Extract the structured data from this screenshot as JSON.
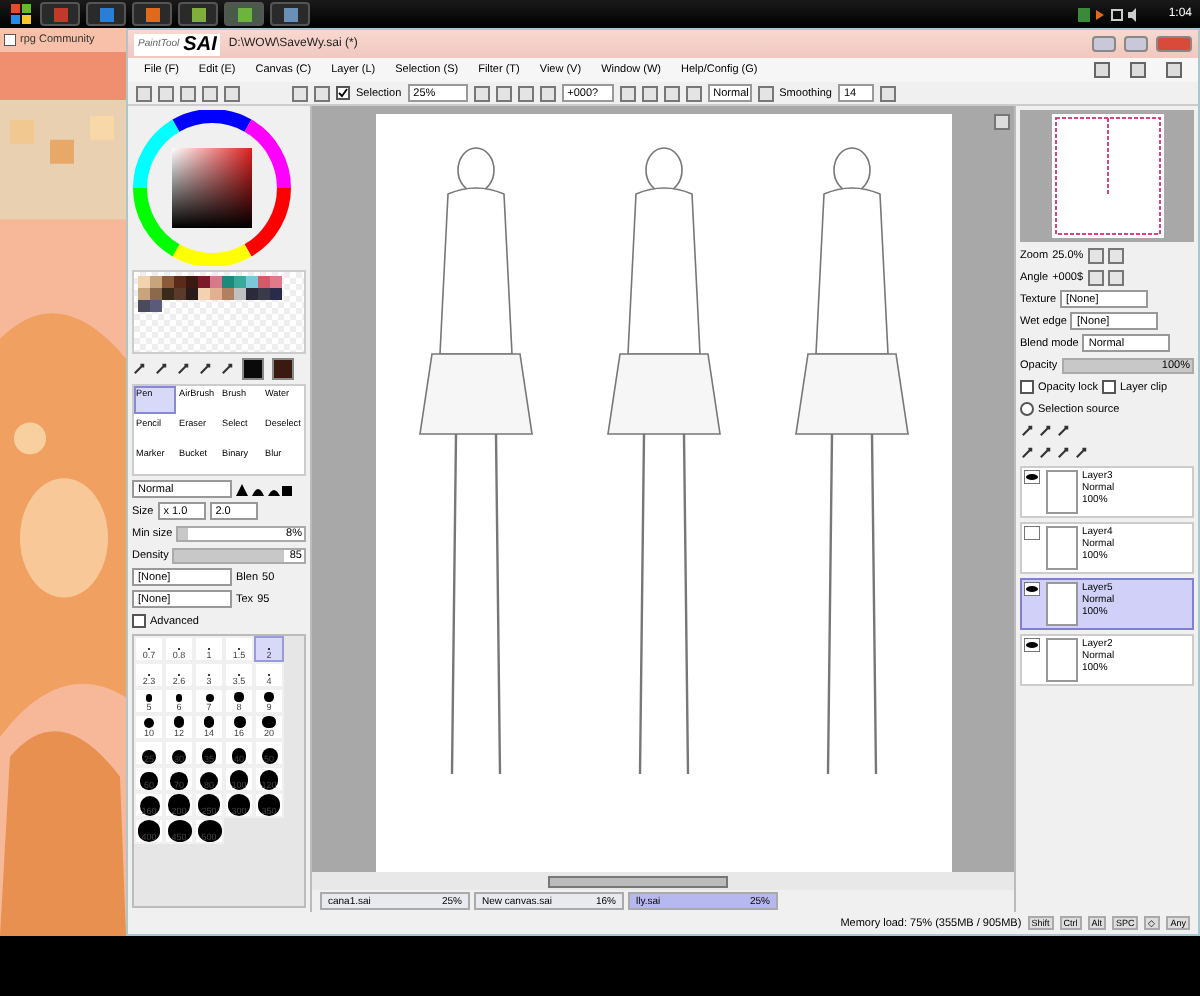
{
  "taskbar": {
    "apps": [
      {
        "color": "#c0392b",
        "selected": false
      },
      {
        "color": "#2a7fd4",
        "selected": false
      },
      {
        "color": "#e06a1a",
        "selected": false
      },
      {
        "color": "#7fae3a",
        "selected": false
      },
      {
        "color": "#6db33f",
        "selected": true
      },
      {
        "color": "#6a90b8",
        "selected": false
      }
    ],
    "clock": "1:04"
  },
  "browser": {
    "tab": "rpg Community"
  },
  "window": {
    "logo_sub": "PaintTool",
    "logo": "SAI",
    "title": "D:\\WOW\\SaveWy.sai (*)"
  },
  "menu": [
    "File (F)",
    "Edit (E)",
    "Canvas (C)",
    "Layer (L)",
    "Selection (S)",
    "Filter (T)",
    "View (V)",
    "Window (W)",
    "Help/Config (G)"
  ],
  "toolbar": {
    "selection_checked": true,
    "selection_label": "Selection",
    "zoom": "25%",
    "angle": "+000?",
    "blend": "Normal",
    "smoothing_label": "Smoothing",
    "smoothing": "14"
  },
  "swatches": [
    {
      "color": "#f2d2b0"
    },
    {
      "color": "#c8a47c"
    },
    {
      "color": "#8a5a3a"
    },
    {
      "color": "#5a2a1a"
    },
    {
      "color": "#3a1a10"
    },
    {
      "color": "#7a1a2a"
    },
    {
      "color": "#d47a8a"
    },
    {
      "color": "#1a8a7a"
    },
    {
      "color": "#3aa89a"
    },
    {
      "color": "#7ac8d8"
    },
    {
      "color": "#d45a6a"
    },
    {
      "color": "#e07a8a"
    },
    {
      "color": "#c8a47c"
    },
    {
      "color": "#8a6a4a"
    },
    {
      "color": "#3a2a1a"
    },
    {
      "color": "#5a3a2a"
    },
    {
      "color": "#2a1a1a"
    },
    {
      "color": "#f2d2b0"
    },
    {
      "color": "#e0b090"
    },
    {
      "color": "#b08060"
    },
    {
      "color": "#c0c0c0"
    },
    {
      "color": "#2a2a3a"
    },
    {
      "color": "#3a3a4a"
    },
    {
      "color": "#2a2a4a"
    },
    {
      "color": "#4a4a5a"
    },
    {
      "color": "#5a5a7a"
    }
  ],
  "brush_tools": [
    {
      "label": "Pen",
      "selected": true
    },
    {
      "label": "AirBrush",
      "selected": false
    },
    {
      "label": "Brush",
      "selected": false
    },
    {
      "label": "Water",
      "selected": false
    },
    {
      "label": "Pencil",
      "selected": false
    },
    {
      "label": "Eraser",
      "selected": false
    },
    {
      "label": "Select",
      "selected": false
    },
    {
      "label": "Deselect",
      "selected": false
    },
    {
      "label": "Marker",
      "selected": false
    },
    {
      "label": "Bucket",
      "selected": false
    },
    {
      "label": "Binary",
      "selected": false
    },
    {
      "label": "Blur",
      "selected": false
    }
  ],
  "brush": {
    "blend": "Normal",
    "size_label": "Size",
    "size_mult": "x 1.0",
    "size": "2.0",
    "min": {
      "label": "Min size",
      "value": "8%",
      "level": 0.08
    },
    "density": {
      "label": "Density",
      "value": "85",
      "level": 0.85
    },
    "shape": "[None]",
    "shape_label": "Blen",
    "shape_value": "50",
    "texture": "[None]",
    "texture_label": "Tex",
    "texture_value": "95",
    "advanced_label": "Advanced",
    "advanced": false
  },
  "sizes": [
    {
      "label": "0.7",
      "selected": false
    },
    {
      "label": "0.8",
      "selected": false
    },
    {
      "label": "1",
      "selected": false
    },
    {
      "label": "1.5",
      "selected": false
    },
    {
      "label": "2",
      "selected": true
    },
    {
      "label": "2.3",
      "selected": false
    },
    {
      "label": "2.6",
      "selected": false
    },
    {
      "label": "3",
      "selected": false
    },
    {
      "label": "3.5",
      "selected": false
    },
    {
      "label": "4",
      "selected": false
    },
    {
      "label": "5",
      "selected": false
    },
    {
      "label": "6",
      "selected": false
    },
    {
      "label": "7",
      "selected": false
    },
    {
      "label": "8",
      "selected": false
    },
    {
      "label": "9",
      "selected": false
    },
    {
      "label": "10",
      "selected": false
    },
    {
      "label": "12",
      "selected": false
    },
    {
      "label": "14",
      "selected": false
    },
    {
      "label": "16",
      "selected": false
    },
    {
      "label": "20",
      "selected": false
    },
    {
      "label": "25",
      "selected": false
    },
    {
      "label": "30",
      "selected": false
    },
    {
      "label": "35",
      "selected": false
    },
    {
      "label": "40",
      "selected": false
    },
    {
      "label": "50",
      "selected": false
    },
    {
      "label": "60",
      "selected": false
    },
    {
      "label": "70",
      "selected": false
    },
    {
      "label": "80",
      "selected": false
    },
    {
      "label": "100",
      "selected": false
    },
    {
      "label": "120",
      "selected": false
    },
    {
      "label": "160",
      "selected": false
    },
    {
      "label": "200",
      "selected": false
    },
    {
      "label": "250",
      "selected": false
    },
    {
      "label": "300",
      "selected": false
    },
    {
      "label": "350",
      "selected": false
    },
    {
      "label": "400",
      "selected": false
    },
    {
      "label": "450",
      "selected": false
    },
    {
      "label": "500",
      "selected": false
    }
  ],
  "canvas_tabs": [
    {
      "name": "cana1.sai",
      "zoom": "25%",
      "selected": false
    },
    {
      "name": "New canvas.sai",
      "zoom": "16%",
      "selected": false
    },
    {
      "name": "lly.sai",
      "zoom": "25%",
      "selected": true
    }
  ],
  "navigator": {
    "zoom_label": "Zoom",
    "zoom": "25.0%",
    "angle_label": "Angle",
    "angle": "+000$"
  },
  "texture": {
    "label": "Texture",
    "value": "[None]",
    "wet_label": "Wet edge",
    "wet_value": "[None]"
  },
  "layer_props": {
    "blend_label": "Blend mode",
    "blend": "Normal",
    "opacity": {
      "label": "Opacity",
      "value": "100%",
      "level": 1
    },
    "opacity_lock_label": "Opacity lock",
    "opacity_lock": false,
    "clip_label": "Layer clip",
    "clip": false,
    "source_label": "Selection source",
    "source": false
  },
  "layers": [
    {
      "name": "Layer3",
      "mode": "Normal",
      "opacity": "100%",
      "visible": true,
      "selected": false
    },
    {
      "name": "Layer4",
      "mode": "Normal",
      "opacity": "100%",
      "visible": false,
      "selected": false
    },
    {
      "name": "Layer5",
      "mode": "Normal",
      "opacity": "100%",
      "visible": true,
      "selected": true
    },
    {
      "name": "Layer2",
      "mode": "Normal",
      "opacity": "100%",
      "visible": true,
      "selected": false
    }
  ],
  "status": {
    "memory": "Memory load: 75% (355MB / 905MB)",
    "keys": [
      "Shift",
      "Ctrl",
      "Alt",
      "SPC",
      "◇",
      "Any"
    ]
  }
}
